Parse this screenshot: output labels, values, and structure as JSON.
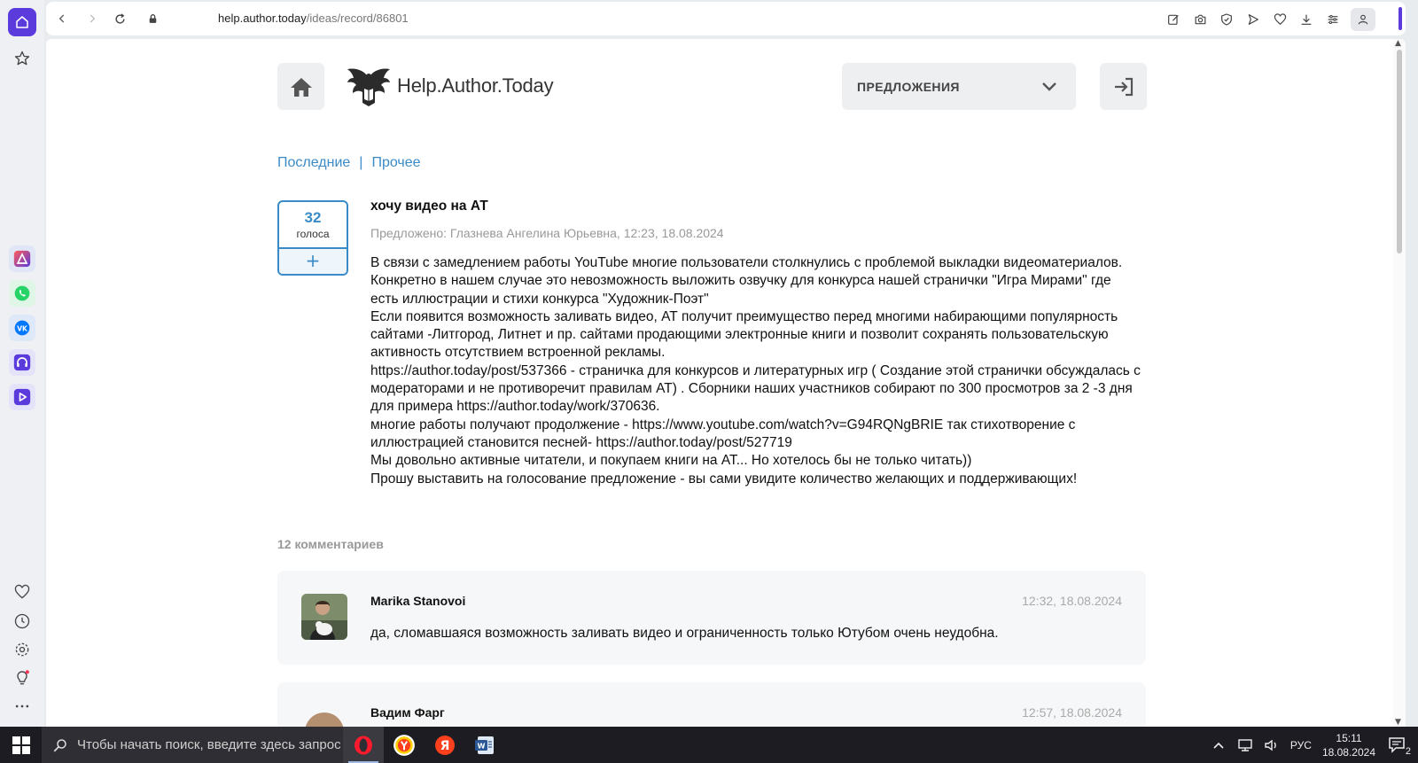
{
  "browser": {
    "url_domain": "help.author.today",
    "url_path": "/ideas/record/86801"
  },
  "site": {
    "logo_text": "Help.Author.Today",
    "dropdown_label": "ПРЕДЛОЖЕНИЯ"
  },
  "filters": {
    "latest": "Последние",
    "separator": "|",
    "other": "Прочее"
  },
  "idea": {
    "votes": "32",
    "votes_label": "голоса",
    "vote_plus": "+",
    "title": "хочу видео на АТ",
    "meta": "Предложено: Глазнева Ангелина Юрьевна, 12:23, 18.08.2024",
    "body": [
      "В связи с замедлением работы YouTube многие пользователи столкнулись с проблемой выкладки видеоматериалов.",
      "Конкретно в нашем случае это невозможность выложить озвучку для конкурса нашей странички \"Игра Мирами\" где есть иллюстрации и стихи конкурса \"Художник-Поэт\"",
      "Если появится возможность заливать видео, АТ получит преимущество перед многими набирающими популярность сайтами -Литгород, Литнет и пр. сайтами продающими электронные книги и позволит сохранять пользовательскую активность отсутствием встроенной рекламы.",
      "https://author.today/post/537366 - страничка для конкурсов и литературных игр ( Создание этой странички обсуждалась с модераторами и не противоречит правилам АТ) . Сборники наших участников собирают по 300 просмотров за 2 -3 дня для примера https://author.today/work/370636.",
      "многие работы получают продолжение - https://www.youtube.com/watch?v=G94RQNgBRIE так стихотворение с иллюстрацией становится песней- https://author.today/post/527719",
      "Мы довольно активные читатели, и покупаем книги на АТ... Но хотелось бы не только читать))",
      "Прошу выставить на голосование предложение - вы сами увидите количество желающих и поддерживающих!"
    ]
  },
  "comments": {
    "count_label": "12 комментариев",
    "items": [
      {
        "author": "Marika Stanovoi",
        "date": "12:32, 18.08.2024",
        "text": "да, сломавшаяся возможность заливать видео и ограниченность только Ютубом очень неудобна."
      },
      {
        "author": "Вадим Фарг",
        "date": "12:57, 18.08.2024",
        "text": ""
      }
    ]
  },
  "taskbar": {
    "search_placeholder": "Чтобы начать поиск, введите здесь запрос",
    "lang": "РУС",
    "time": "15:11",
    "date": "18.08.2024",
    "notifications": "2"
  },
  "colors": {
    "accent": "#3a8bc8",
    "browser_accent": "#5b3bdc"
  }
}
